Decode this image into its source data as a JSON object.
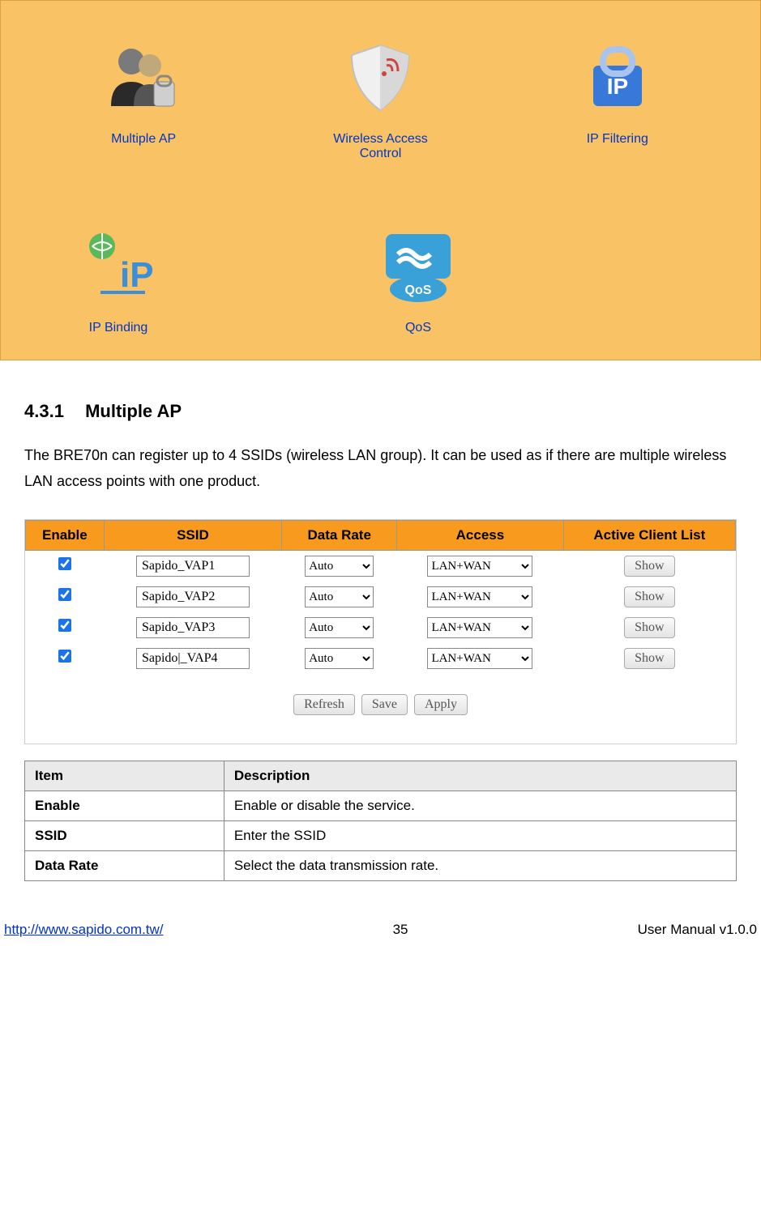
{
  "icon_panel": {
    "items": [
      {
        "label": "Multiple AP",
        "icon": "multiple-ap"
      },
      {
        "label": "Wireless Access Control",
        "icon": "shield"
      },
      {
        "label": "IP Filtering",
        "icon": "ip-lock"
      },
      {
        "label": "IP Binding",
        "icon": "ip-globe"
      },
      {
        "label": "QoS",
        "icon": "qos"
      }
    ]
  },
  "section": {
    "number": "4.3.1",
    "title": "Multiple AP",
    "paragraph": "The BRE70n can register up to 4 SSIDs (wireless LAN group).    It can be used as if there are multiple wireless LAN access points with one product."
  },
  "ssid_panel": {
    "headers": [
      "Enable",
      "SSID",
      "Data Rate",
      "Access",
      "Active Client List"
    ],
    "rows": [
      {
        "enable": true,
        "ssid": "Sapido_VAP1",
        "data_rate": "Auto",
        "access": "LAN+WAN",
        "show": "Show"
      },
      {
        "enable": true,
        "ssid": "Sapido_VAP2",
        "data_rate": "Auto",
        "access": "LAN+WAN",
        "show": "Show"
      },
      {
        "enable": true,
        "ssid": "Sapido_VAP3",
        "data_rate": "Auto",
        "access": "LAN+WAN",
        "show": "Show"
      },
      {
        "enable": true,
        "ssid": "Sapido|_VAP4",
        "data_rate": "Auto",
        "access": "LAN+WAN",
        "show": "Show"
      }
    ],
    "actions": {
      "refresh": "Refresh",
      "save": "Save",
      "apply": "Apply"
    }
  },
  "desc_table": {
    "headers": [
      "Item",
      "Description"
    ],
    "rows": [
      {
        "item": "Enable",
        "desc": "Enable or disable the service."
      },
      {
        "item": "SSID",
        "desc": "Enter the SSID"
      },
      {
        "item": "Data Rate",
        "desc": "Select the data transmission rate."
      }
    ]
  },
  "footer": {
    "left": "http://www.sapido.com.tw/",
    "center": "35",
    "right": "User Manual v1.0.0"
  }
}
